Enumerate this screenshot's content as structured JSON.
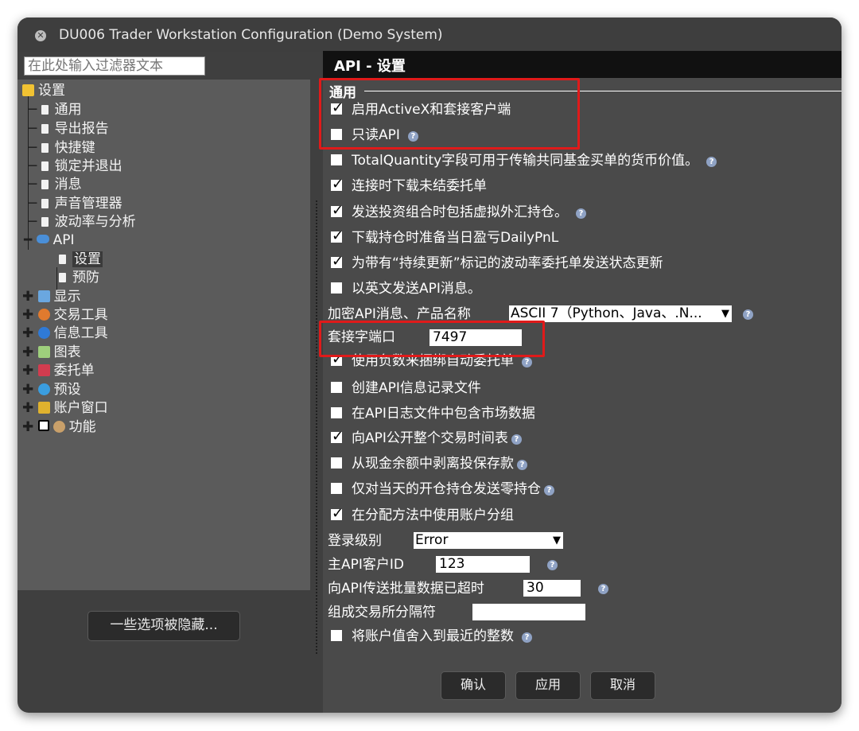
{
  "window": {
    "title": "DU006 Trader Workstation Configuration (Demo System)"
  },
  "sidebar": {
    "filter_placeholder": "在此处输入过滤器文本",
    "root": "设置",
    "settings_items": [
      "通用",
      "导出报告",
      "快捷键",
      "锁定并退出",
      "消息",
      "声音管理器",
      "波动率与分析"
    ],
    "api": {
      "label": "API",
      "children": [
        "设置",
        "预防"
      ]
    },
    "groups": [
      "显示",
      "交易工具",
      "信息工具",
      "图表",
      "委托单",
      "预设",
      "账户窗口",
      "功能"
    ],
    "hidden_button": "一些选项被隐藏..."
  },
  "panel": {
    "title": "API - 设置",
    "group_title": "通用",
    "options": [
      {
        "label": "启用ActiveX和套接客户端",
        "checked": true,
        "help": false
      },
      {
        "label": "只读API",
        "checked": false,
        "help": true
      },
      {
        "label": "TotalQuantity字段可用于传输共同基金买单的货币价值。",
        "checked": false,
        "help": true
      },
      {
        "label": "连接时下载未结委托单",
        "checked": true,
        "help": false
      },
      {
        "label": "发送投资组合时包括虚拟外汇持仓。",
        "checked": true,
        "help": true
      },
      {
        "label": "下载持仓时准备当日盈亏DailyPnL",
        "checked": true,
        "help": false
      },
      {
        "label": "为带有“持续更新”标记的波动率委托单发送状态更新",
        "checked": true,
        "help": false
      },
      {
        "label": "以英文发送API消息。",
        "checked": false,
        "help": false
      }
    ],
    "encoding": {
      "label": "加密API消息、产品名称",
      "value": "ASCII 7（Python、Java、.N..."
    },
    "socket_port": {
      "label": "套接字端口",
      "value": "7497"
    },
    "options2": [
      {
        "label": "使用负数来捆绑自动委托单",
        "checked": true,
        "help": true
      },
      {
        "label": "创建API信息记录文件",
        "checked": false,
        "help": false
      },
      {
        "label": "在API日志文件中包含市场数据",
        "checked": false,
        "help": false
      },
      {
        "label": "向API公开整个交易时间表",
        "checked": true,
        "help": true
      },
      {
        "label": "从现金余额中剥离投保存款",
        "checked": false,
        "help": true
      },
      {
        "label": "仅对当天的开仓持仓发送零持仓",
        "checked": false,
        "help": true
      },
      {
        "label": "在分配方法中使用账户分组",
        "checked": true,
        "help": false
      }
    ],
    "log_level": {
      "label": "登录级别",
      "value": "Error"
    },
    "master_client_id": {
      "label": "主API客户ID",
      "value": "123"
    },
    "timeout": {
      "label": "向API传送批量数据已超时",
      "value": "30"
    },
    "separator": {
      "label": "组成交易所分隔符",
      "value": ""
    },
    "round_option": {
      "label": "将账户值舍入到最近的整数",
      "checked": false,
      "help": true
    }
  },
  "buttons": {
    "ok": "确认",
    "apply": "应用",
    "cancel": "取消"
  },
  "colors": {
    "highlight": "#e01a1a",
    "help_icon": "#8fa2c4"
  }
}
